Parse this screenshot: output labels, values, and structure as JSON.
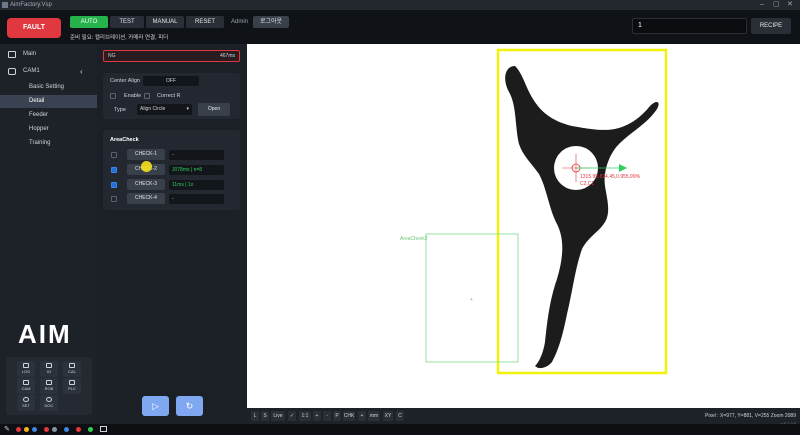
{
  "window": {
    "title": "AimFactory.Vsp"
  },
  "topbar": {
    "fault_label": "FAULT",
    "modes": [
      {
        "label": "AUTO",
        "active": true
      },
      {
        "label": "TEST",
        "active": false
      },
      {
        "label": "MANUAL",
        "active": false
      },
      {
        "label": "RESET",
        "active": false
      }
    ],
    "admin_label": "Admin",
    "logout_label": "로그아웃",
    "status_message": "준비 필요: 캘리브레이션, 카메라 연결, 피더",
    "recipe_value": "1",
    "recipe_label": "RECIPE"
  },
  "sidebar": {
    "main_label": "Main",
    "cam_label": "CAM1",
    "items": [
      {
        "label": "Basic Setting",
        "active": false
      },
      {
        "label": "Detail",
        "active": true
      },
      {
        "label": "Feeder",
        "active": false
      },
      {
        "label": "Hopper",
        "active": false
      },
      {
        "label": "Training",
        "active": false
      }
    ],
    "logo_text": "AIM",
    "tools": [
      {
        "label": "LOG",
        "icon": "log-icon"
      },
      {
        "label": "IO",
        "icon": "io-icon"
      },
      {
        "label": "CAL",
        "icon": "calibration-icon"
      },
      {
        "label": "CAM",
        "icon": "camera-icon"
      },
      {
        "label": "ROB",
        "icon": "robot-icon"
      },
      {
        "label": "PLC",
        "icon": "plc-icon"
      },
      {
        "label": "SET",
        "icon": "settings-icon"
      },
      {
        "label": "DOC",
        "icon": "doc-icon"
      }
    ]
  },
  "detail": {
    "ng_label": "NG",
    "ng_time": "467ms",
    "center_align_label": "Center Align",
    "center_align_toggle": "OFF",
    "enable_label": "Enable",
    "correct_r_label": "Correct R",
    "type_label": "Type",
    "type_value": "Align Circle",
    "open_label": "Open",
    "area_check_title": "AreaCheck",
    "checks": [
      {
        "label": "CHECK-1",
        "checked": false,
        "result": "-",
        "result_color": "#cfd4da"
      },
      {
        "label": "CHECK-2",
        "checked": true,
        "result": "J078ms | n=8",
        "result_color": "#2fd05a"
      },
      {
        "label": "CHECK-3",
        "checked": true,
        "result": "11ms | 1x",
        "result_color": "#2fd05a"
      },
      {
        "label": "CHECK-4",
        "checked": false,
        "result": "-",
        "result_color": "#cfd4da"
      }
    ]
  },
  "viewer": {
    "roi_label": "AreaCheck2",
    "measure_text": "1315.99,874.45,0.955,99%",
    "measure_text2": "C2,C1",
    "toolbar": [
      "L",
      "S",
      "Live",
      "✓",
      "1:1",
      "+",
      "-",
      "P",
      "CHK",
      "+",
      "mm",
      "XY",
      "C"
    ],
    "pixel_info": "Pixel : X=977, Y=881, V=255   Zoom 2089",
    "version": "v 0.1.0.0"
  },
  "colors": {
    "accent_green": "#25b24a",
    "fault_red": "#e0383e",
    "roi_yellow": "#f2f20a",
    "roi_green": "#7edc8a"
  }
}
